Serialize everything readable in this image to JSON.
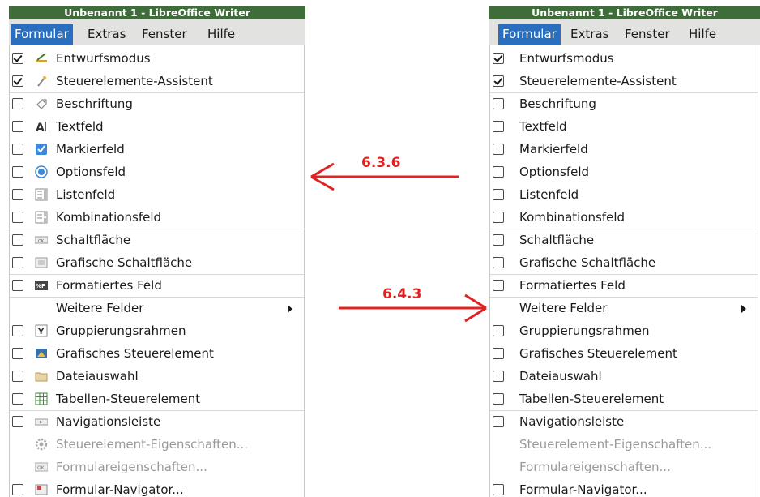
{
  "window_title": "Unbenannt 1 - LibreOffice Writer",
  "menubar": [
    "Formular",
    "Extras",
    "Fenster",
    "Hilfe"
  ],
  "menu_items": [
    {
      "label": "Entwurfsmodus",
      "checked": true,
      "icon": "design-mode-icon"
    },
    {
      "label": "Steuerelemente-Assistent",
      "checked": true,
      "icon": "wizard-icon"
    },
    {
      "label": "Beschriftung",
      "checked": false,
      "icon": "label-icon"
    },
    {
      "label": "Textfeld",
      "checked": false,
      "icon": "textbox-icon"
    },
    {
      "label": "Markierfeld",
      "checked": false,
      "icon": "checkbox-field-icon"
    },
    {
      "label": "Optionsfeld",
      "checked": false,
      "icon": "radio-button-icon"
    },
    {
      "label": "Listenfeld",
      "checked": false,
      "icon": "listbox-icon"
    },
    {
      "label": "Kombinationsfeld",
      "checked": false,
      "icon": "combobox-icon"
    },
    {
      "label": "Schaltfläche",
      "checked": false,
      "icon": "push-button-icon"
    },
    {
      "label": "Grafische Schaltfläche",
      "checked": false,
      "icon": "image-button-icon"
    },
    {
      "label": "Formatiertes Feld",
      "checked": false,
      "icon": "formatted-field-icon"
    },
    {
      "label": "Weitere Felder",
      "submenu": true
    },
    {
      "label": "Gruppierungsrahmen",
      "checked": false,
      "icon": "group-box-icon"
    },
    {
      "label": "Grafisches Steuerelement",
      "checked": false,
      "icon": "image-control-icon"
    },
    {
      "label": "Dateiauswahl",
      "checked": false,
      "icon": "file-selection-icon"
    },
    {
      "label": "Tabellen-Steuerelement",
      "checked": false,
      "icon": "table-control-icon"
    },
    {
      "label": "Navigationsleiste",
      "checked": false,
      "icon": "navigation-bar-icon"
    },
    {
      "label": "Steuerelement-Eigenschaften...",
      "disabled": true,
      "icon": "control-properties-icon"
    },
    {
      "label": "Formulareigenschaften...",
      "disabled": true,
      "icon": "form-properties-icon"
    },
    {
      "label": "Formular-Navigator...",
      "checked": false,
      "icon": "form-navigator-icon"
    }
  ],
  "annotations": {
    "left_arrow_label": "6.3.6",
    "right_arrow_label": "6.4.3",
    "arrow_color": "#e02222"
  },
  "colors": {
    "titlebar": "#3f6d3a",
    "menu_active": "#2a6fbf",
    "disabled_text": "#9a9a9a"
  }
}
